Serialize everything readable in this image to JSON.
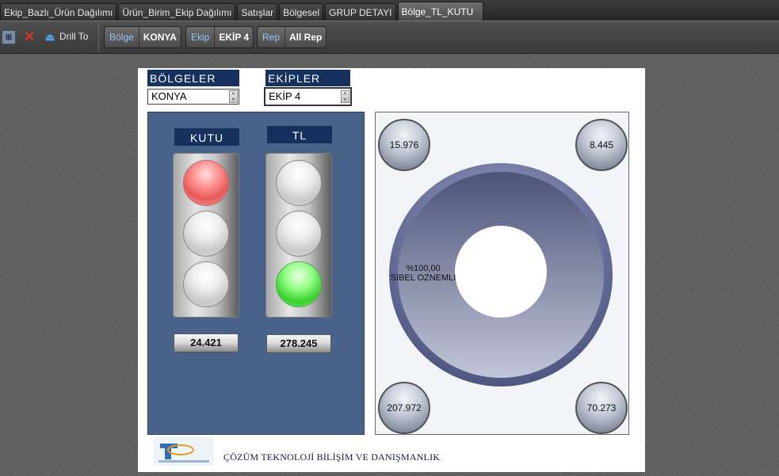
{
  "tabs": [
    {
      "label": "Ekip_Bazlı_Ürün Dağılımı",
      "active": false
    },
    {
      "label": "Ürün_Birim_Ekip Dağılımı",
      "active": false
    },
    {
      "label": "Satışlar",
      "active": false
    },
    {
      "label": "Bölgesel",
      "active": false
    },
    {
      "label": "GRUP DETAYI",
      "active": false
    },
    {
      "label": "Bölge_TL_KUTU",
      "active": true
    }
  ],
  "toolbar": {
    "filter_icon": "filter-icon",
    "delete_icon": "delete-icon",
    "drill_icon": "drill-icon",
    "drill_label": "Drill To",
    "selections": [
      {
        "key": "Bölge",
        "value": "KONYA"
      },
      {
        "key": "Ekip",
        "value": "EKİP 4"
      },
      {
        "key": "Rep",
        "value": "All Rep"
      }
    ]
  },
  "report": {
    "region_selector": {
      "label": "BÖLGELER",
      "value": "KONYA"
    },
    "team_selector": {
      "label": "EKİPLER",
      "value": "EKİP 4"
    },
    "kutu": {
      "title": "KUTU",
      "value": "24.421",
      "active_light": "red"
    },
    "tl": {
      "title": "TL",
      "value": "278.245",
      "active_light": "green"
    },
    "donut": {
      "percent_label": "%100,00",
      "name_label": "SIBEL OZNEMLI",
      "fill_color": "#6b739f",
      "corner_values": {
        "top_left": "15.976",
        "top_right": "8.445",
        "bottom_left": "207.972",
        "bottom_right": "70.273"
      }
    },
    "company_name": "ÇÖZÜM TEKNOLOJİ BİLİŞİM VE DANIŞMANLIK"
  }
}
